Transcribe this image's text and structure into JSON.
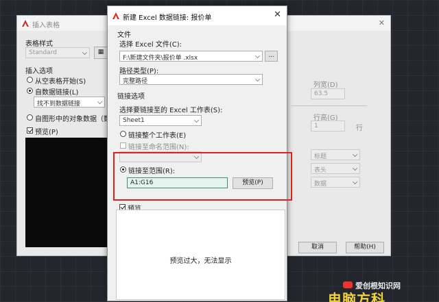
{
  "insert_table": {
    "title": "插入表格",
    "close": "✕",
    "table_style_label": "表格样式",
    "table_style_value": "Standard",
    "insert_options_label": "插入选项",
    "option_empty": "从空表格开始(S)",
    "option_data_link": "自数据链接(L)",
    "data_link_combo": "找不到数据链接",
    "option_drawing_data": "自图形中的对象数据（数",
    "preview_check": "预览(P)",
    "col_width_label": "列宽(D)",
    "col_width_value": "63.5",
    "row_height_label": "行高(G)",
    "row_height_value": "1",
    "row_unit": "行",
    "style_title": "标题",
    "style_header": "表头",
    "style_data": "数据",
    "cancel": "取消",
    "help": "帮助(H)"
  },
  "new_link": {
    "title": "新建 Excel 数据链接: 报价单",
    "close": "✕",
    "file_section": "文件",
    "select_file_label": "选择 Excel 文件(C):",
    "file_path": "F:\\新建文件夹\\报价单  .xlsx",
    "browse": "...",
    "path_type_label": "路径类型(P):",
    "path_type_value": "完整路径",
    "link_options": "链接选项",
    "sheet_label": "选择要链接至的 Excel 工作表(S):",
    "sheet_value": "Sheet1",
    "link_whole_sheet": "链接整个工作表(E)",
    "link_named_range": "链接至命名范围(N):",
    "link_to_range": "链接至范围(R):",
    "range_value": "A1:G16",
    "preview_button": "预览(P)",
    "preview_check": "预览",
    "preview_message": "预览过大，无法显示"
  },
  "watermark": {
    "line1": "爱创根知识网",
    "line2": "电脑方科"
  },
  "colors": {
    "highlight": "#e0201a",
    "range_field": "#e3f5ee"
  }
}
